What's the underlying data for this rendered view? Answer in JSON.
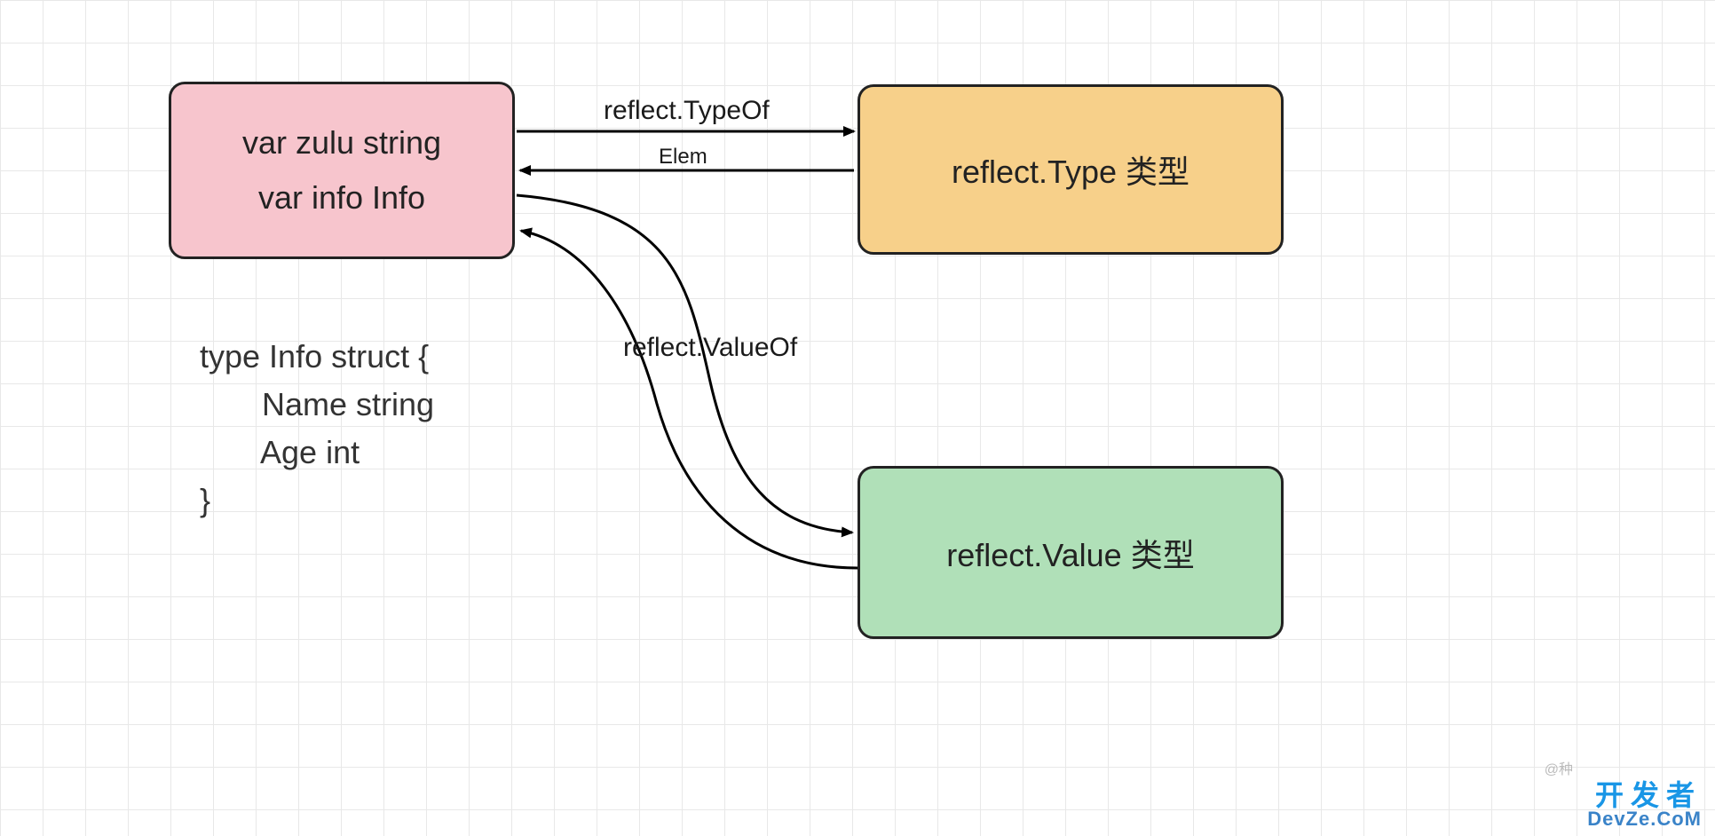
{
  "boxes": {
    "source": {
      "line1": "var zulu string",
      "line2": "var info Info"
    },
    "type": {
      "label": "reflect.Type 类型"
    },
    "value": {
      "label": "reflect.Value 类型"
    }
  },
  "struct_def": "type Info struct {\n       Name string\n       Age int\n}",
  "edges": {
    "typeof": "reflect.TypeOf",
    "elem": "Elem",
    "valueof": "reflect.ValueOf"
  },
  "watermark": {
    "cn": "开发者",
    "en": "DevZe.CoM",
    "small": "@种"
  },
  "colors": {
    "source_bg": "#f7c5cd",
    "type_bg": "#f7d08a",
    "value_bg": "#b0e0b8",
    "stroke": "#222222"
  }
}
